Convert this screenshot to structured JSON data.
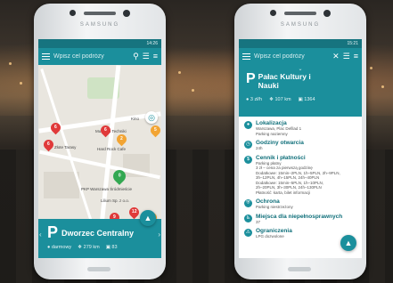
{
  "left_phone": {
    "brand": "SAMSUNG",
    "status_time": "14:26",
    "search_placeholder": "Wpisz cel podróży",
    "map_labels": {
      "zlote_tarasy": "Złote Tarasy",
      "muzeum": "Muzeum Techniki",
      "hard_rock": "Hard Rock Cafe",
      "lilium": "Lilium Sp. z o.o.",
      "pkp": "PKP Warszawa Śródmieście",
      "kino": "Kino"
    },
    "pins": [
      "6",
      "6",
      "6",
      "5",
      "2",
      "0",
      "9",
      "12",
      "0",
      "4"
    ],
    "sheet": {
      "name": "Dworzec Centralny",
      "price": "darmowy",
      "distance": "279 km",
      "spaces": "83"
    }
  },
  "right_phone": {
    "brand": "SAMSUNG",
    "status_time": "15:21",
    "search_placeholder": "Wpisz cel podróży",
    "title_line1": "Pałac Kultury i",
    "title_line2": "Nauki",
    "price": "3 zł/h",
    "distance": "107 km",
    "spaces": "1364",
    "sections": [
      {
        "icon": "location-pin-icon",
        "title": "Lokalizacja",
        "text": "Warszawa, Plac Defilad 1\nParking naziemny"
      },
      {
        "icon": "clock-icon",
        "title": "Godziny otwarcia",
        "text": "24h"
      },
      {
        "icon": "coin-icon",
        "title": "Cennik i płatności",
        "text": "Parking płatny\n3 zł – cena za pierwszą godzinę\nDodatkowe: 15min–2PLN, 1h–5PLN, 2h–9PLN,\n3h–12PLN, 4h–15PLN, 24h–40PLN\nDodatkowe: 15min–5PLN, 1h–10PLN,\n2h–20PLN, 3h–30PLN, 24h–130PLN\nPłatność: karta, bilet informacji"
      },
      {
        "icon": "shield-icon",
        "title": "Ochrona",
        "text": "Parking niestrzeżony"
      },
      {
        "icon": "wheelchair-icon",
        "title": "Miejsca dla niepełnosprawnych",
        "text": "37"
      },
      {
        "icon": "warning-icon",
        "title": "Ograniczenia",
        "text": "LPG dozwolone"
      }
    ]
  },
  "colors": {
    "teal": "#1b8f9c",
    "teal_dark": "#16747f",
    "pin_red": "#e03a3a",
    "pin_orange": "#f2a433",
    "pin_green": "#33a852"
  }
}
